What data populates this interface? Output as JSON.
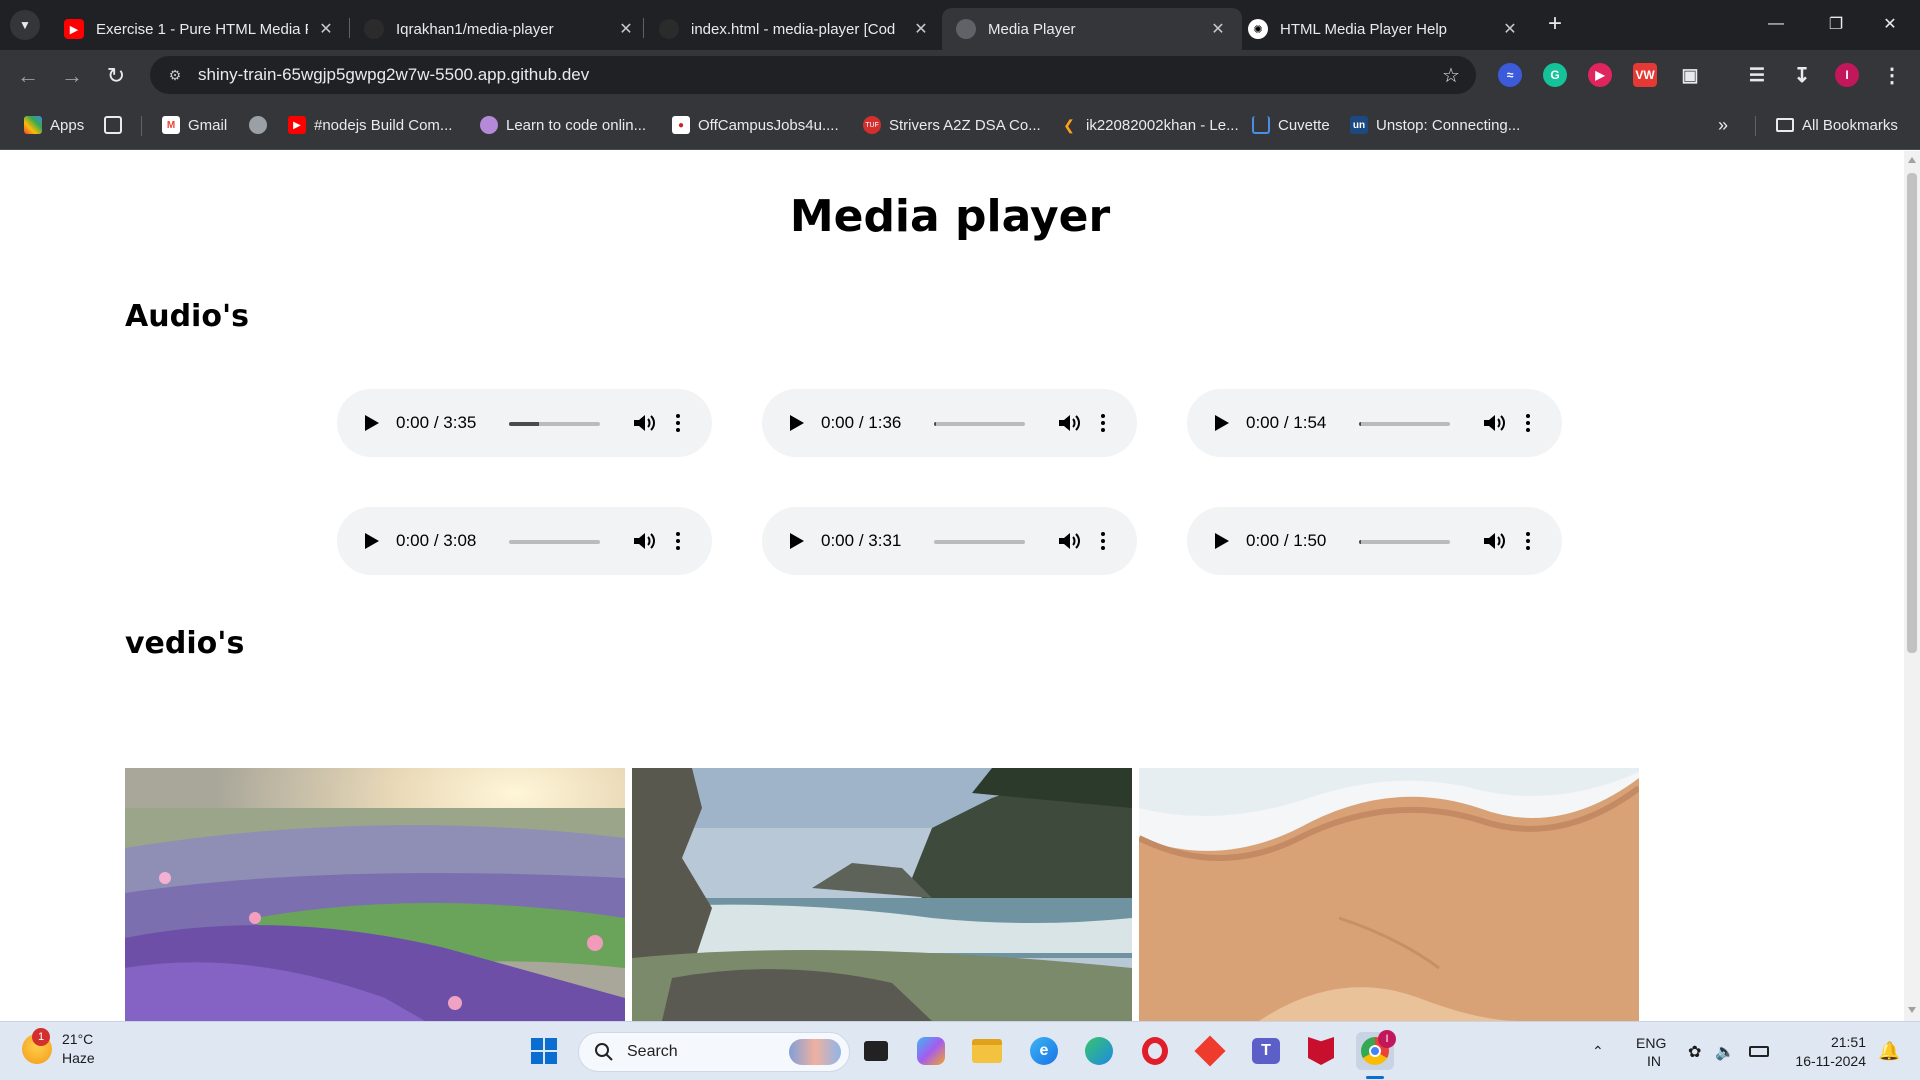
{
  "browser": {
    "tabs": [
      {
        "title": "Exercise 1 - Pure HTML Media P",
        "favicon": "youtube-icon",
        "active": false
      },
      {
        "title": "Iqrakhan1/media-player",
        "favicon": "github-icon",
        "active": false
      },
      {
        "title": "index.html - media-player [Cod",
        "favicon": "github-icon",
        "active": false
      },
      {
        "title": "Media Player",
        "favicon": "globe-icon",
        "active": true
      },
      {
        "title": "HTML Media Player Help",
        "favicon": "chatgpt-icon",
        "active": false
      }
    ],
    "url": "shiny-train-65wgjp5gwpg2w7w-5500.app.github.dev",
    "bookmarks": [
      {
        "label": "Apps",
        "icon": "apps-grid-icon"
      },
      {
        "label": "",
        "icon": "grid-icon"
      },
      {
        "label": "Gmail",
        "icon": "gmail-icon"
      },
      {
        "label": "",
        "icon": "globe-icon"
      },
      {
        "label": "#nodejs Build Com...",
        "icon": "youtube-icon"
      },
      {
        "label": "Learn to code onlin...",
        "icon": "avatar-icon"
      },
      {
        "label": "OffCampusJobs4u....",
        "icon": "site-icon"
      },
      {
        "label": "Strivers A2Z DSA Co...",
        "icon": "tuf-icon"
      },
      {
        "label": "ik22082002khan - Le...",
        "icon": "leetcode-icon"
      },
      {
        "label": "Cuvette",
        "icon": "cuvette-icon"
      },
      {
        "label": "Unstop: Connecting...",
        "icon": "unstop-icon"
      }
    ],
    "all_bookmarks": "All Bookmarks",
    "colors": {
      "frame": "#202124",
      "toolbar": "#35363a",
      "text": "#e8eaed"
    }
  },
  "page": {
    "title": "Media player",
    "audio_heading": "Audio's",
    "video_heading": "vedio's",
    "audio_players": [
      {
        "current": "0:00",
        "duration": "3:35",
        "buffered_fraction": 0.33
      },
      {
        "current": "0:00",
        "duration": "1:36",
        "buffered_fraction": 0.02
      },
      {
        "current": "0:00",
        "duration": "1:54",
        "buffered_fraction": 0.02
      },
      {
        "current": "0:00",
        "duration": "3:08",
        "buffered_fraction": 0.0
      },
      {
        "current": "0:00",
        "duration": "3:31",
        "buffered_fraction": 0.0
      },
      {
        "current": "0:00",
        "duration": "1:50",
        "buffered_fraction": 0.02
      }
    ],
    "videos": [
      {
        "thumbnail": "lavender-field-sunset"
      },
      {
        "thumbnail": "rocky-coast-waves"
      },
      {
        "thumbnail": "aerial-beach-sand"
      }
    ]
  },
  "taskbar": {
    "weather_temp": "21°C",
    "weather_desc": "Haze",
    "weather_badge": "1",
    "search_label": "Search",
    "language": "ENG",
    "region": "IN",
    "time": "21:51",
    "date": "16-11-2024",
    "chrome_badge": "I"
  }
}
